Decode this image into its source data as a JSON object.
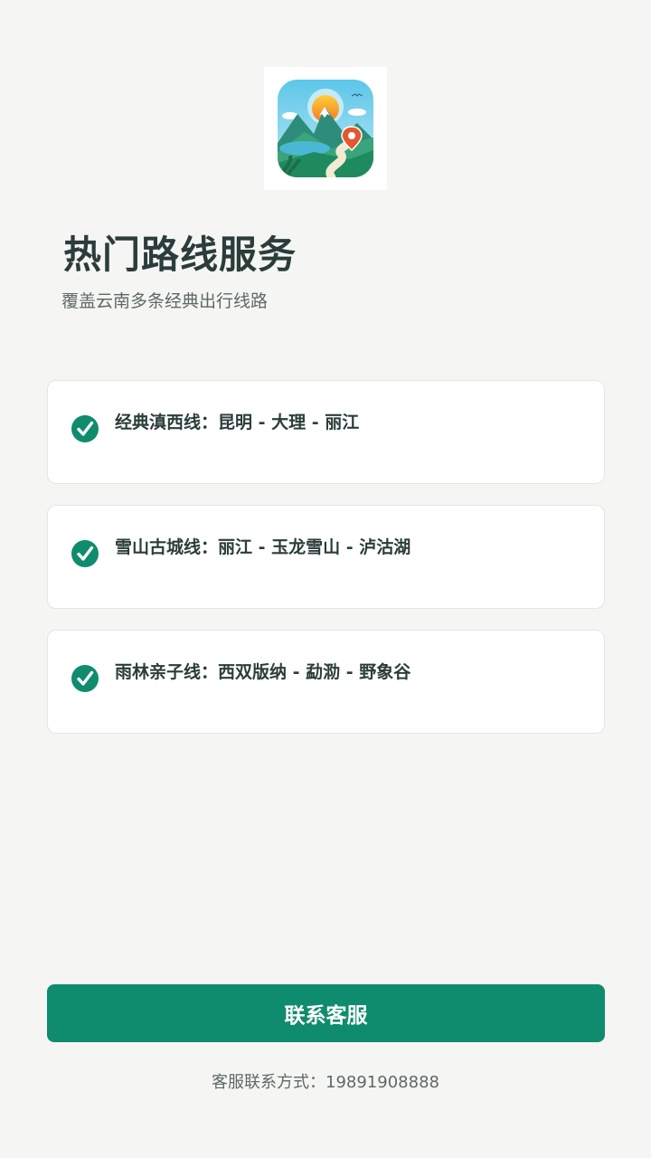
{
  "header": {
    "logo_icon": "mountain-route-map-pin-icon",
    "title": "热门路线服务",
    "subtitle": "覆盖云南多条经典出行线路"
  },
  "routes": [
    {
      "label": "经典滇西线：昆明 - 大理 - 丽江",
      "icon": "check-circle-icon"
    },
    {
      "label": "雪山古城线：丽江 - 玉龙雪山 - 泸沽湖",
      "icon": "check-circle-icon"
    },
    {
      "label": "雨林亲子线：西双版纳 - 勐泐 - 野象谷",
      "icon": "check-circle-icon"
    }
  ],
  "footer": {
    "button_label": "联系客服",
    "contact_text": "客服联系方式：19891908888"
  },
  "colors": {
    "accent": "#0f8c6d",
    "background": "#f5f6f4",
    "text": "#2b3d3a"
  }
}
